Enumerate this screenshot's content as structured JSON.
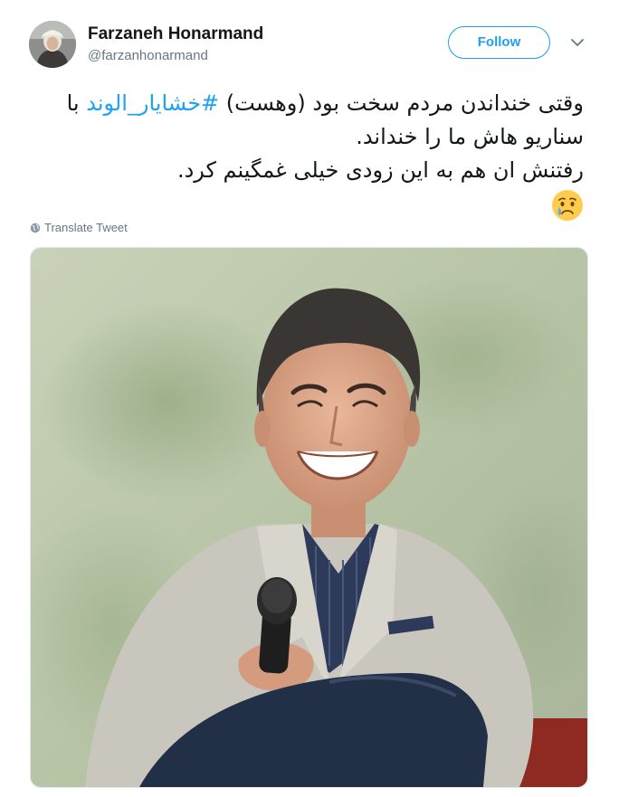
{
  "user": {
    "name": "Farzaneh Honarmand",
    "handle": "@farzanhonarmand"
  },
  "follow_button": {
    "label": "Follow"
  },
  "tweet": {
    "line1_before": "وقتی خنداندن مردم سخت بود (وهست) ",
    "hashtag": "#خشایار_الوند",
    "line1_after": "  با",
    "line2": "سناریو هاش ما را خنداند.",
    "line3": "رفتنش ان هم به این زودی خیلی غمگینم کرد.",
    "emoji": "crying-face-emoji"
  },
  "translate": {
    "label": "Translate Tweet",
    "icon": "globe-icon"
  },
  "colors": {
    "accent": "#1da1f2",
    "text": "#14171a",
    "secondary": "#657786"
  }
}
